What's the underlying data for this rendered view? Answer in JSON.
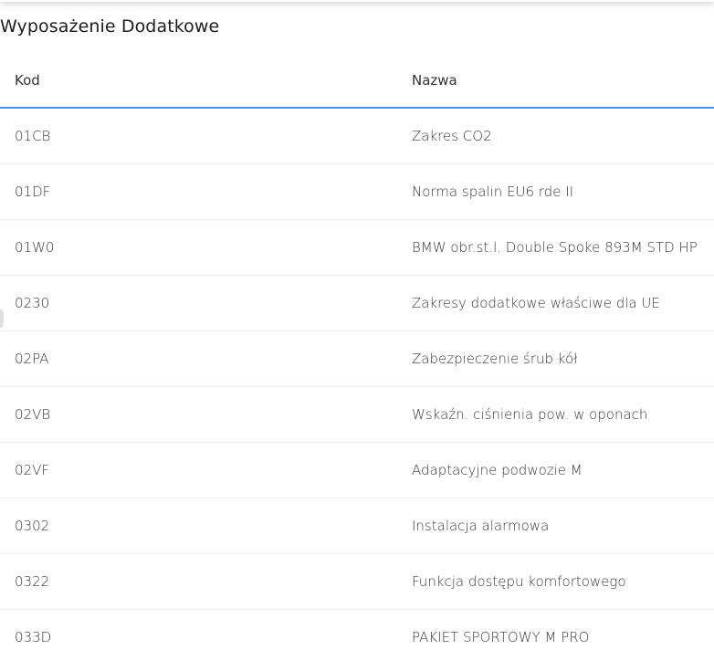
{
  "section": {
    "title": "Wyposażenie Dodatkowe"
  },
  "table": {
    "headers": {
      "code": "Kod",
      "name": "Nazwa"
    },
    "rows": [
      {
        "code": "01CB",
        "name": "Zakres CO2"
      },
      {
        "code": "01DF",
        "name": "Norma spalin EU6 rde II"
      },
      {
        "code": "01W0",
        "name": "BMW obr.st.l. Double Spoke 893M STD HP"
      },
      {
        "code": "0230",
        "name": "Zakresy dodatkowe właściwe dla UE"
      },
      {
        "code": "02PA",
        "name": "Zabezpieczenie śrub kół"
      },
      {
        "code": "02VB",
        "name": "Wskaźn. ciśnienia pow. w oponach"
      },
      {
        "code": "02VF",
        "name": "Adaptacyjne podwozie M"
      },
      {
        "code": "0302",
        "name": "Instalacja alarmowa"
      },
      {
        "code": "0322",
        "name": "Funkcja dostępu komfortowego"
      },
      {
        "code": "033D",
        "name": "PAKIET SPORTOWY M PRO"
      }
    ]
  },
  "colors": {
    "header_underline": "#4a90e2",
    "row_divider": "#efefef"
  }
}
